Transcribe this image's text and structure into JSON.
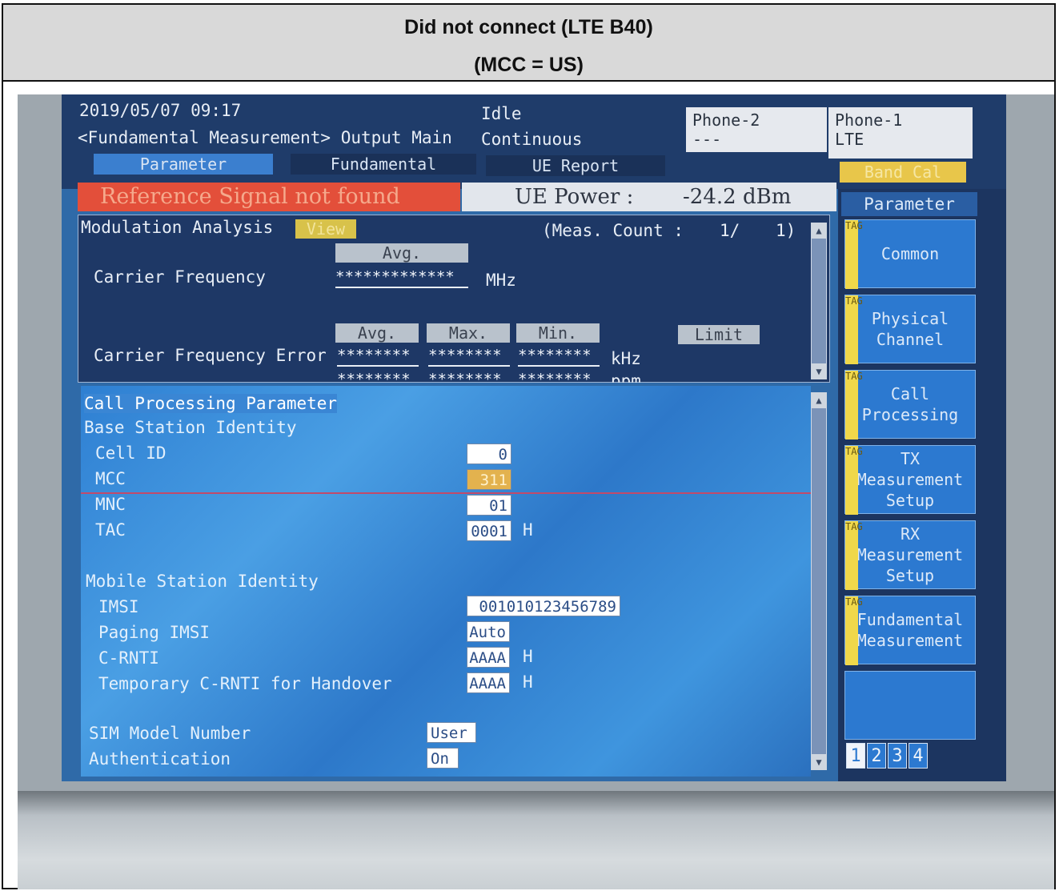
{
  "caption": {
    "line1": "Did not connect (LTE B40)",
    "line2": "(MCC = US)"
  },
  "status": {
    "datetime": "2019/05/07 09:17",
    "state": "Idle",
    "screen": "<Fundamental Measurement> Output Main",
    "mode": "Continuous",
    "phone2_label": "Phone-2",
    "phone2_value": "---",
    "phone1_label": "Phone-1",
    "phone1_value": "LTE"
  },
  "tabs": {
    "parameter": "Parameter",
    "fundamental": "Fundamental",
    "ue_report": "UE Report",
    "band_cal": "Band Cal"
  },
  "banner": {
    "text": "Reference Signal not found"
  },
  "ue_power": {
    "label": "UE Power :",
    "value": "-24.2 dBm"
  },
  "modulation": {
    "title": "Modulation Analysis",
    "view_button": "View",
    "meas_count_label": "(Meas. Count :",
    "meas_count_value": "1/",
    "meas_count_total": "1)",
    "carrier_frequency_label": "Carrier Frequency",
    "avg_label": "Avg.",
    "carrier_frequency_value": "*************",
    "carrier_frequency_unit": "MHz",
    "cfe_label": "Carrier Frequency Error",
    "cfe_avg": "********",
    "cfe_max": "********",
    "cfe_min": "********",
    "cfe_unit": "kHz",
    "cfe_avg2": "********",
    "cfe_max2": "********",
    "cfe_min2": "********",
    "cfe_unit2": "ppm",
    "max_label": "Max.",
    "min_label": "Min.",
    "limit_label": "Limit"
  },
  "call_processing": {
    "title": "Call Processing Parameter",
    "base_station_identity": "Base Station Identity",
    "cell_id_label": "Cell ID",
    "cell_id_value": "0",
    "mcc_label": "MCC",
    "mcc_value": "311",
    "mnc_label": "MNC",
    "mnc_value": "01",
    "tac_label": "TAC",
    "tac_value": "0001",
    "tac_unit": "H",
    "mobile_station_identity": "Mobile Station Identity",
    "imsi_label": "IMSI",
    "imsi_value": "001010123456789",
    "paging_imsi_label": "Paging IMSI",
    "paging_imsi_value": "Auto",
    "c_rnti_label": "C-RNTI",
    "c_rnti_value": "AAAA",
    "c_rnti_unit": "H",
    "temp_c_rnti_label": "Temporary C-RNTI for Handover",
    "temp_c_rnti_value": "AAAA",
    "temp_c_rnti_unit": "H",
    "sim_model_label": "SIM Model Number",
    "sim_model_value": "User",
    "authentication_label": "Authentication",
    "authentication_value": "On"
  },
  "side_menu": {
    "header": "Parameter",
    "tag_text": "TAG",
    "common": "Common",
    "physical_channel_1": "Physical",
    "physical_channel_2": "Channel",
    "call_processing_1": "Call",
    "call_processing_2": "Processing",
    "tx_1": "TX",
    "tx_2": "Measurement",
    "tx_3": "Setup",
    "rx_1": "RX",
    "rx_2": "Measurement",
    "rx_3": "Setup",
    "fund_1": "Fundamental",
    "fund_2": "Measurement",
    "pages": [
      "1",
      "2",
      "3",
      "4"
    ]
  },
  "colors": {
    "lcd_blue": "#2f6aa8",
    "banner_red": "#e34f3a",
    "band_cal_yellow": "#e8c64a"
  }
}
